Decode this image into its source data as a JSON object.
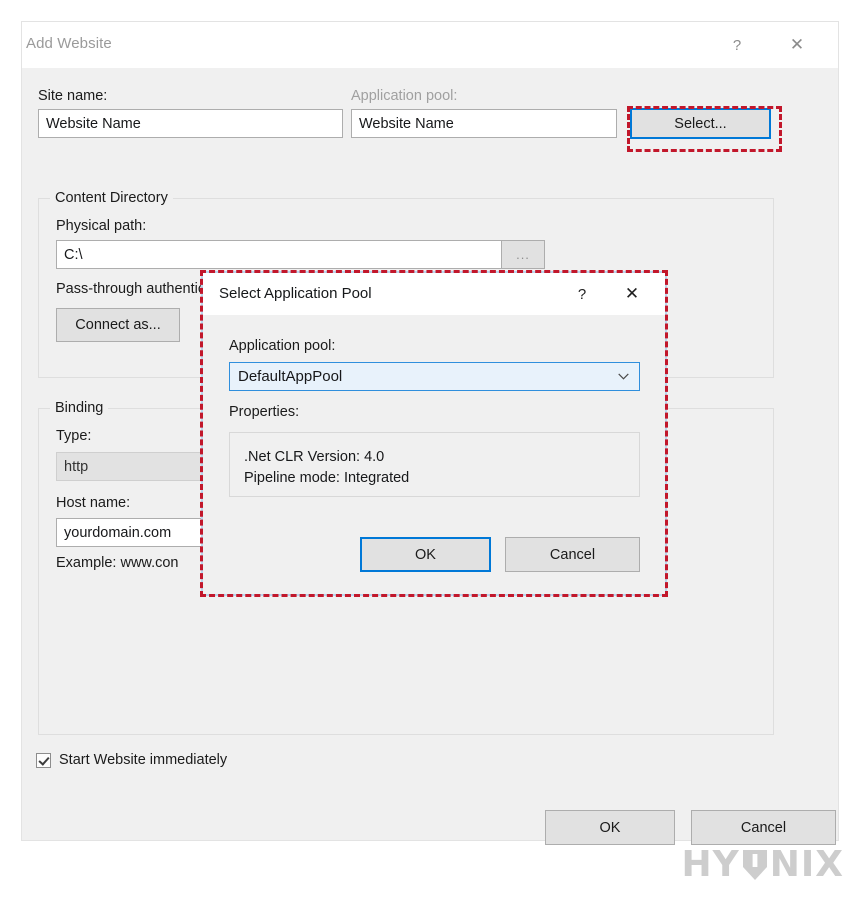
{
  "window": {
    "title": "Add Website",
    "help_icon": "?",
    "close_icon": "✕"
  },
  "form": {
    "site_name_label": "Site name:",
    "site_name_value": "Website Name",
    "app_pool_label": "Application pool:",
    "app_pool_value": "Website Name",
    "select_button": "Select..."
  },
  "content_directory": {
    "group_title": "Content Directory",
    "physical_path_label": "Physical path:",
    "physical_path_value": "C:\\",
    "browse_button": "...",
    "pass_through_label": "Pass-through authentication",
    "connect_as_button": "Connect as..."
  },
  "binding": {
    "group_title": "Binding",
    "type_label": "Type:",
    "type_value": "http",
    "host_name_label": "Host name:",
    "host_name_value": "yourdomain.com",
    "example_text": "Example: www.con"
  },
  "footer": {
    "start_website_label": "Start Website immediately",
    "start_website_checked": true,
    "ok_button": "OK",
    "cancel_button": "Cancel"
  },
  "modal": {
    "title": "Select Application Pool",
    "help_icon": "?",
    "close_icon": "✕",
    "app_pool_label": "Application pool:",
    "app_pool_value": "DefaultAppPool",
    "properties_label": "Properties:",
    "properties_lines": [
      ".Net CLR Version: 4.0",
      "Pipeline mode: Integrated"
    ],
    "ok_button": "OK",
    "cancel_button": "Cancel"
  },
  "watermark": {
    "text_before": "HY",
    "text_after": "NIX"
  },
  "colors": {
    "highlight": "#c2172b",
    "focus_blue": "#0078d7",
    "dialog_bg": "#f0f0f0",
    "combo_bg": "#e8f2fb"
  }
}
